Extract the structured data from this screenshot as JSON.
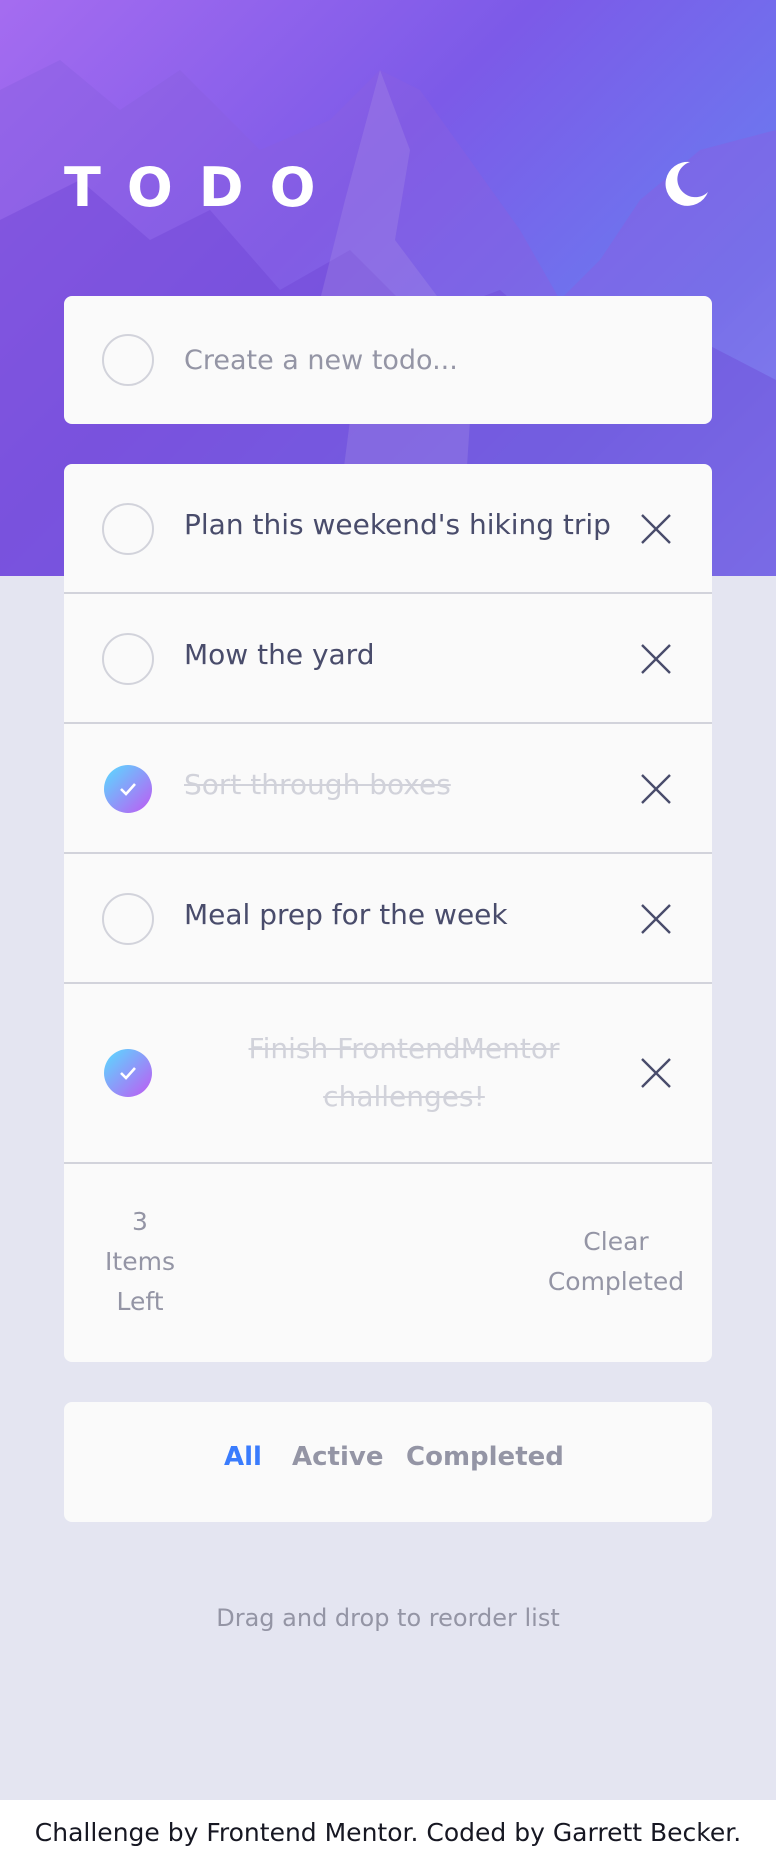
{
  "colors": {
    "accent": "#3a7cfd",
    "check_gradient_start": "#57ddff",
    "check_gradient_end": "#c058f3",
    "card_bg": "#fafafa",
    "page_bg": "#e4e5f1"
  },
  "header": {
    "title": "TODO",
    "theme_icon": "moon-icon"
  },
  "new_todo": {
    "placeholder": "Create a new todo..."
  },
  "todos": [
    {
      "text": "Plan this weekend's hiking trip",
      "completed": false
    },
    {
      "text": "Mow the yard",
      "completed": false
    },
    {
      "text": "Sort through boxes",
      "completed": true
    },
    {
      "text": "Meal prep for the week",
      "completed": false
    },
    {
      "text": "Finish FrontendMentor challenges!",
      "completed": true
    }
  ],
  "footer": {
    "items_left": "3 Items Left",
    "clear_label": "Clear Completed"
  },
  "filters": {
    "all": "All",
    "active": "Active",
    "completed": "Completed",
    "selected": "All"
  },
  "hint": "Drag and drop to reorder list",
  "attribution": "Challenge by Frontend Mentor. Coded by Garrett Becker."
}
